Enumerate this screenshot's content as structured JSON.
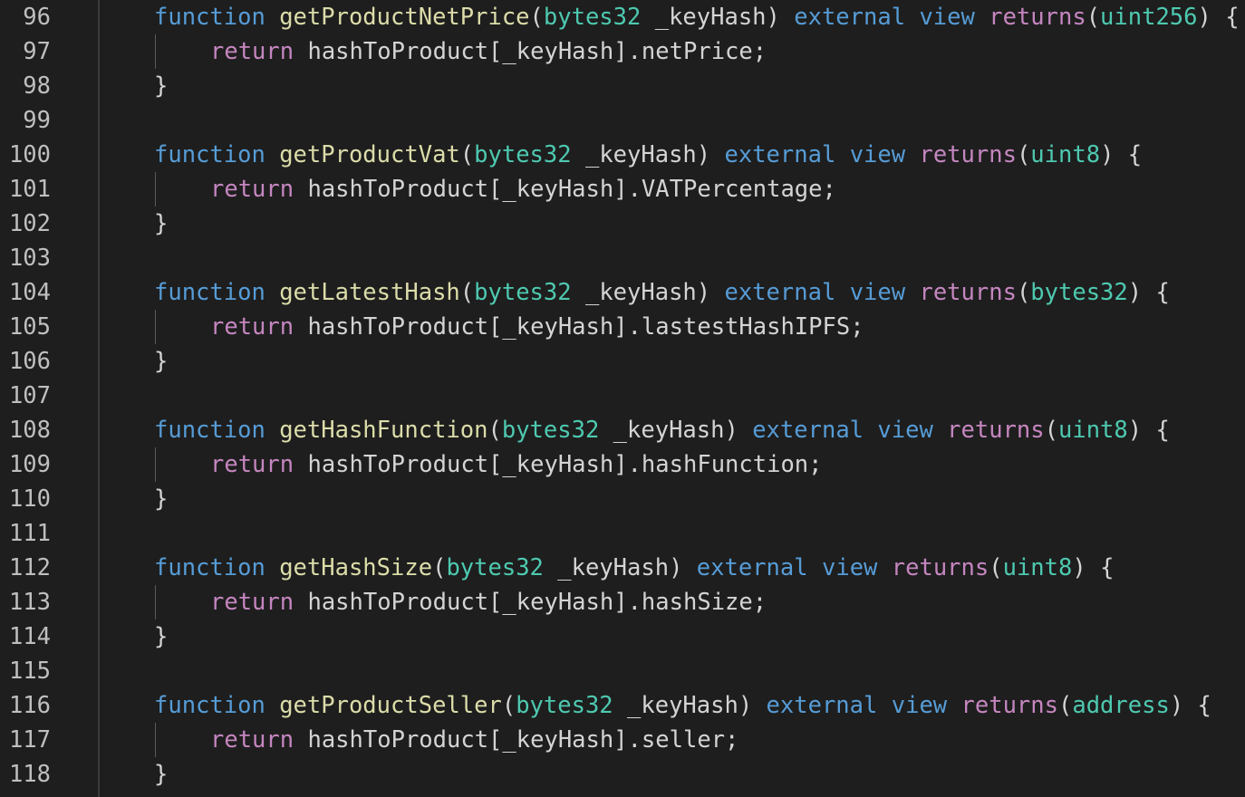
{
  "editor": {
    "theme_colors": {
      "background": "#1e1e1e",
      "line_number": "#bfbfbf",
      "keyword": "#569cd6",
      "function_name": "#dcdcaa",
      "type": "#4ec9b0",
      "control": "#c586c0",
      "text": "#d4d4d4"
    },
    "lines": [
      {
        "num": "96",
        "kw1": "function",
        "fn": "getProductNetPrice",
        "p1": "(",
        "ty1": "bytes32",
        "param": " _keyHash) ",
        "kw2": "external",
        "sp1": " ",
        "kw3": "view",
        "sp2": " ",
        "ret": "returns",
        "p2": "(",
        "ty2": "uint256",
        "p3": ") {"
      },
      {
        "num": "97",
        "ret": "return",
        "body": " hashToProduct[_keyHash].netPrice;"
      },
      {
        "num": "98",
        "close": "}"
      },
      {
        "num": "99"
      },
      {
        "num": "100",
        "kw1": "function",
        "fn": "getProductVat",
        "p1": "(",
        "ty1": "bytes32",
        "param": " _keyHash) ",
        "kw2": "external",
        "sp1": " ",
        "kw3": "view",
        "sp2": " ",
        "ret": "returns",
        "p2": "(",
        "ty2": "uint8",
        "p3": ") {"
      },
      {
        "num": "101",
        "ret": "return",
        "body": " hashToProduct[_keyHash].VATPercentage;"
      },
      {
        "num": "102",
        "close": "}"
      },
      {
        "num": "103"
      },
      {
        "num": "104",
        "kw1": "function",
        "fn": "getLatestHash",
        "p1": "(",
        "ty1": "bytes32",
        "param": " _keyHash) ",
        "kw2": "external",
        "sp1": " ",
        "kw3": "view",
        "sp2": " ",
        "ret": "returns",
        "p2": "(",
        "ty2": "bytes32",
        "p3": ") {"
      },
      {
        "num": "105",
        "ret": "return",
        "body": " hashToProduct[_keyHash].lastestHashIPFS;"
      },
      {
        "num": "106",
        "close": "}"
      },
      {
        "num": "107"
      },
      {
        "num": "108",
        "kw1": "function",
        "fn": "getHashFunction",
        "p1": "(",
        "ty1": "bytes32",
        "param": " _keyHash) ",
        "kw2": "external",
        "sp1": " ",
        "kw3": "view",
        "sp2": " ",
        "ret": "returns",
        "p2": "(",
        "ty2": "uint8",
        "p3": ") {"
      },
      {
        "num": "109",
        "ret": "return",
        "body": " hashToProduct[_keyHash].hashFunction;"
      },
      {
        "num": "110",
        "close": "}"
      },
      {
        "num": "111"
      },
      {
        "num": "112",
        "kw1": "function",
        "fn": "getHashSize",
        "p1": "(",
        "ty1": "bytes32",
        "param": " _keyHash) ",
        "kw2": "external",
        "sp1": " ",
        "kw3": "view",
        "sp2": " ",
        "ret": "returns",
        "p2": "(",
        "ty2": "uint8",
        "p3": ") {"
      },
      {
        "num": "113",
        "ret": "return",
        "body": " hashToProduct[_keyHash].hashSize;"
      },
      {
        "num": "114",
        "close": "}"
      },
      {
        "num": "115"
      },
      {
        "num": "116",
        "kw1": "function",
        "fn": "getProductSeller",
        "p1": "(",
        "ty1": "bytes32",
        "param": " _keyHash) ",
        "kw2": "external",
        "sp1": " ",
        "kw3": "view",
        "sp2": " ",
        "ret": "returns",
        "p2": "(",
        "ty2": "address",
        "p3": ") {"
      },
      {
        "num": "117",
        "ret": "return",
        "body": " hashToProduct[_keyHash].seller;"
      },
      {
        "num": "118",
        "close": "}"
      }
    ]
  }
}
